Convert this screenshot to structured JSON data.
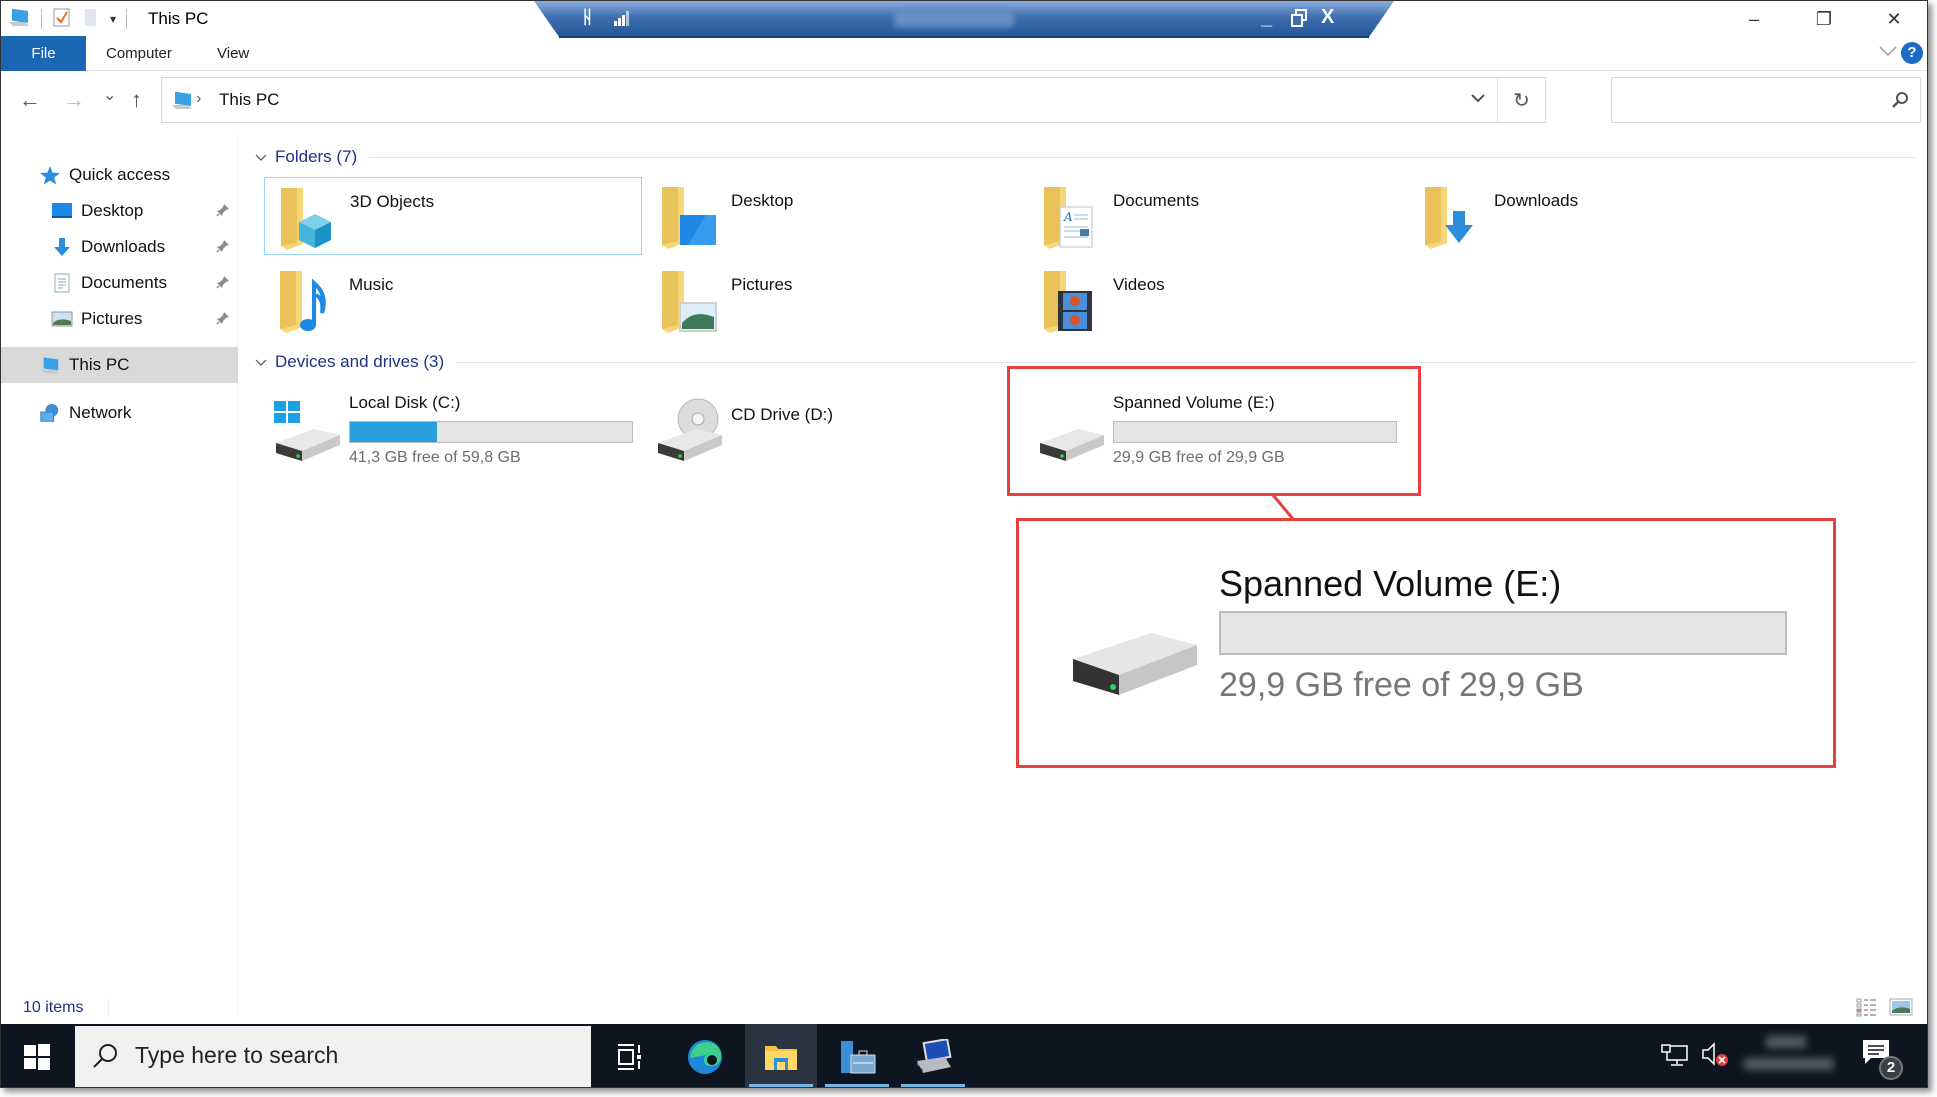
{
  "window": {
    "title": "This PC",
    "minimize": "–",
    "maximize": "❐",
    "close": "✕"
  },
  "rdp_bar": {
    "pin": "pin-icon",
    "signal": "connection-quality-icon",
    "minimize": "_",
    "restore": "restore-icon",
    "close": "X"
  },
  "ribbon": {
    "tabs": [
      {
        "label": "File",
        "active": true
      },
      {
        "label": "Computer"
      },
      {
        "label": "View"
      }
    ],
    "expand_icon": "chevron-down-icon",
    "help": "?"
  },
  "navigation": {
    "back": "←",
    "forward": "→",
    "recent": "⌄",
    "up": "↑",
    "breadcrumb": [
      "This PC"
    ],
    "separator": "›",
    "dropdown": "⌄",
    "refresh": "↻",
    "search_placeholder": ""
  },
  "sidebar": {
    "items": [
      {
        "label": "Quick access",
        "icon": "star-icon"
      },
      {
        "label": "Desktop",
        "icon": "desktop-icon",
        "pinned": true
      },
      {
        "label": "Downloads",
        "icon": "download-icon",
        "pinned": true
      },
      {
        "label": "Documents",
        "icon": "documents-icon",
        "pinned": true
      },
      {
        "label": "Pictures",
        "icon": "pictures-icon",
        "pinned": true
      },
      {
        "label": "This PC",
        "icon": "computer-icon",
        "selected": true
      },
      {
        "label": "Network",
        "icon": "network-icon"
      }
    ],
    "pin_glyph": "📌"
  },
  "content": {
    "folders_header": "Folders (7)",
    "folders": [
      {
        "name": "3D Objects",
        "icon": "3d-objects-folder-icon",
        "selected": true
      },
      {
        "name": "Desktop",
        "icon": "desktop-folder-icon"
      },
      {
        "name": "Documents",
        "icon": "documents-folder-icon"
      },
      {
        "name": "Downloads",
        "icon": "downloads-folder-icon"
      },
      {
        "name": "Music",
        "icon": "music-folder-icon"
      },
      {
        "name": "Pictures",
        "icon": "pictures-folder-icon"
      },
      {
        "name": "Videos",
        "icon": "videos-folder-icon"
      }
    ],
    "devices_header": "Devices and drives (3)",
    "drives": [
      {
        "name": "Local Disk (C:)",
        "free_text": "41,3 GB free of 59,8 GB",
        "used_fraction": 0.31,
        "icon": "system-drive-icon"
      },
      {
        "name": "CD Drive (D:)",
        "icon": "cd-drive-icon"
      },
      {
        "name": "Spanned Volume (E:)",
        "free_text": "29,9 GB free of 29,9 GB",
        "used_fraction": 0.0,
        "icon": "hard-drive-icon",
        "highlighted": true
      }
    ]
  },
  "callout": {
    "name": "Spanned Volume (E:)",
    "free_text": "29,9 GB free of 29,9 GB",
    "used_fraction": 0.0,
    "highlight_color": "#e8403f"
  },
  "statusbar": {
    "items_count": "10 items"
  },
  "taskbar": {
    "search_placeholder": "Type here to search",
    "apps": [
      {
        "name": "task-view",
        "active": false
      },
      {
        "name": "edge",
        "active": false
      },
      {
        "name": "file-explorer",
        "active": true
      },
      {
        "name": "server-manager",
        "active": false
      },
      {
        "name": "remote-desktop",
        "active": false
      }
    ],
    "notification_count": "2"
  },
  "colors": {
    "accent": "#1b67b4",
    "progress": "#26a0da",
    "group_header": "#1e3287",
    "highlight": "#e8403f",
    "taskbar": "#0d1520"
  }
}
